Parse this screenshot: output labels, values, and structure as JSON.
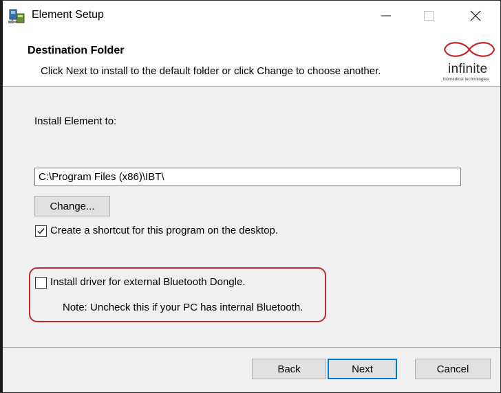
{
  "window": {
    "title": "Element Setup",
    "icon": "installer-icon",
    "controls": [
      "minimize-icon",
      "maximize-icon",
      "close-icon"
    ]
  },
  "header": {
    "title": "Destination Folder",
    "description": "Click Next to install to the default folder or click Change to choose another.",
    "logo": {
      "word": "infinite",
      "subtitle": "biomedical technologies",
      "color": "#c0282c"
    }
  },
  "body": {
    "install_label": "Install Element to:",
    "path_value": "C:\\Program Files (x86)\\IBT\\",
    "change_label": "Change...",
    "shortcut": {
      "checked": true,
      "label": "Create a shortcut for this program on the desktop."
    },
    "driver": {
      "checked": false,
      "label": "Install driver for external Bluetooth Dongle.",
      "note": "Note: Uncheck this if your PC has internal Bluetooth."
    },
    "highlight_color": "#c0282c"
  },
  "footer": {
    "back_label": "Back",
    "next_label": "Next",
    "cancel_label": "Cancel"
  }
}
